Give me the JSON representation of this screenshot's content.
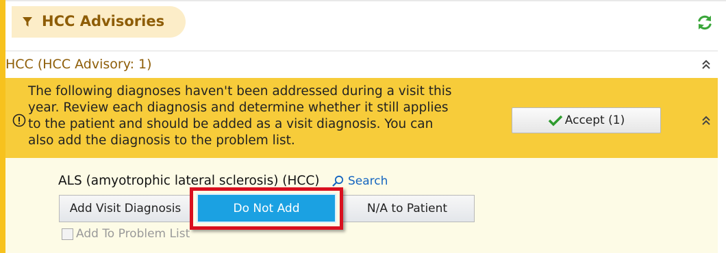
{
  "panel": {
    "title": "HCC Advisories",
    "icons": {
      "filter": "filter-icon",
      "refresh": "refresh-icon"
    },
    "accent_color": "#f7c21e"
  },
  "section": {
    "title": "HCC (HCC Advisory: 1)",
    "collapse_icon": "double-chevron-up-icon"
  },
  "advisory": {
    "message_lines": [
      "The following diagnoses haven't been addressed during a visit this",
      "year. Review each diagnosis and determine whether it still applies",
      "to the patient and should be added as a visit diagnosis. You can",
      "also add the diagnosis to the problem list."
    ],
    "accept_label": "Accept (1)",
    "band_color": "#f7cc3a"
  },
  "diagnosis": {
    "name": "ALS (amyotrophic lateral sclerosis) (HCC)",
    "search_label": "Search",
    "buttons": {
      "add_visit": "Add Visit Diagnosis",
      "do_not_add": "Do Not Add",
      "na_patient": "N/A to Patient"
    },
    "selected_button": "Do Not Add",
    "selected_color": "#1ba1e2",
    "problem_list_label": "Add To Problem List",
    "problem_list_checked": false
  },
  "annotation": {
    "highlight_color": "#d9101f",
    "highlights": "Do Not Add"
  }
}
